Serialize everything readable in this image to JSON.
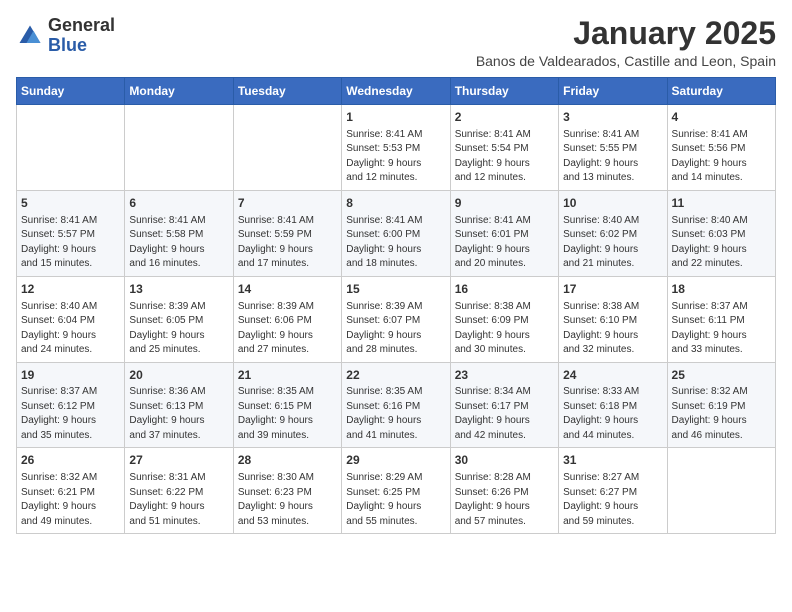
{
  "header": {
    "logo_general": "General",
    "logo_blue": "Blue",
    "month": "January 2025",
    "location": "Banos de Valdearados, Castille and Leon, Spain"
  },
  "days_of_week": [
    "Sunday",
    "Monday",
    "Tuesday",
    "Wednesday",
    "Thursday",
    "Friday",
    "Saturday"
  ],
  "weeks": [
    [
      {
        "day": "",
        "info": ""
      },
      {
        "day": "",
        "info": ""
      },
      {
        "day": "",
        "info": ""
      },
      {
        "day": "1",
        "info": "Sunrise: 8:41 AM\nSunset: 5:53 PM\nDaylight: 9 hours\nand 12 minutes."
      },
      {
        "day": "2",
        "info": "Sunrise: 8:41 AM\nSunset: 5:54 PM\nDaylight: 9 hours\nand 12 minutes."
      },
      {
        "day": "3",
        "info": "Sunrise: 8:41 AM\nSunset: 5:55 PM\nDaylight: 9 hours\nand 13 minutes."
      },
      {
        "day": "4",
        "info": "Sunrise: 8:41 AM\nSunset: 5:56 PM\nDaylight: 9 hours\nand 14 minutes."
      }
    ],
    [
      {
        "day": "5",
        "info": "Sunrise: 8:41 AM\nSunset: 5:57 PM\nDaylight: 9 hours\nand 15 minutes."
      },
      {
        "day": "6",
        "info": "Sunrise: 8:41 AM\nSunset: 5:58 PM\nDaylight: 9 hours\nand 16 minutes."
      },
      {
        "day": "7",
        "info": "Sunrise: 8:41 AM\nSunset: 5:59 PM\nDaylight: 9 hours\nand 17 minutes."
      },
      {
        "day": "8",
        "info": "Sunrise: 8:41 AM\nSunset: 6:00 PM\nDaylight: 9 hours\nand 18 minutes."
      },
      {
        "day": "9",
        "info": "Sunrise: 8:41 AM\nSunset: 6:01 PM\nDaylight: 9 hours\nand 20 minutes."
      },
      {
        "day": "10",
        "info": "Sunrise: 8:40 AM\nSunset: 6:02 PM\nDaylight: 9 hours\nand 21 minutes."
      },
      {
        "day": "11",
        "info": "Sunrise: 8:40 AM\nSunset: 6:03 PM\nDaylight: 9 hours\nand 22 minutes."
      }
    ],
    [
      {
        "day": "12",
        "info": "Sunrise: 8:40 AM\nSunset: 6:04 PM\nDaylight: 9 hours\nand 24 minutes."
      },
      {
        "day": "13",
        "info": "Sunrise: 8:39 AM\nSunset: 6:05 PM\nDaylight: 9 hours\nand 25 minutes."
      },
      {
        "day": "14",
        "info": "Sunrise: 8:39 AM\nSunset: 6:06 PM\nDaylight: 9 hours\nand 27 minutes."
      },
      {
        "day": "15",
        "info": "Sunrise: 8:39 AM\nSunset: 6:07 PM\nDaylight: 9 hours\nand 28 minutes."
      },
      {
        "day": "16",
        "info": "Sunrise: 8:38 AM\nSunset: 6:09 PM\nDaylight: 9 hours\nand 30 minutes."
      },
      {
        "day": "17",
        "info": "Sunrise: 8:38 AM\nSunset: 6:10 PM\nDaylight: 9 hours\nand 32 minutes."
      },
      {
        "day": "18",
        "info": "Sunrise: 8:37 AM\nSunset: 6:11 PM\nDaylight: 9 hours\nand 33 minutes."
      }
    ],
    [
      {
        "day": "19",
        "info": "Sunrise: 8:37 AM\nSunset: 6:12 PM\nDaylight: 9 hours\nand 35 minutes."
      },
      {
        "day": "20",
        "info": "Sunrise: 8:36 AM\nSunset: 6:13 PM\nDaylight: 9 hours\nand 37 minutes."
      },
      {
        "day": "21",
        "info": "Sunrise: 8:35 AM\nSunset: 6:15 PM\nDaylight: 9 hours\nand 39 minutes."
      },
      {
        "day": "22",
        "info": "Sunrise: 8:35 AM\nSunset: 6:16 PM\nDaylight: 9 hours\nand 41 minutes."
      },
      {
        "day": "23",
        "info": "Sunrise: 8:34 AM\nSunset: 6:17 PM\nDaylight: 9 hours\nand 42 minutes."
      },
      {
        "day": "24",
        "info": "Sunrise: 8:33 AM\nSunset: 6:18 PM\nDaylight: 9 hours\nand 44 minutes."
      },
      {
        "day": "25",
        "info": "Sunrise: 8:32 AM\nSunset: 6:19 PM\nDaylight: 9 hours\nand 46 minutes."
      }
    ],
    [
      {
        "day": "26",
        "info": "Sunrise: 8:32 AM\nSunset: 6:21 PM\nDaylight: 9 hours\nand 49 minutes."
      },
      {
        "day": "27",
        "info": "Sunrise: 8:31 AM\nSunset: 6:22 PM\nDaylight: 9 hours\nand 51 minutes."
      },
      {
        "day": "28",
        "info": "Sunrise: 8:30 AM\nSunset: 6:23 PM\nDaylight: 9 hours\nand 53 minutes."
      },
      {
        "day": "29",
        "info": "Sunrise: 8:29 AM\nSunset: 6:25 PM\nDaylight: 9 hours\nand 55 minutes."
      },
      {
        "day": "30",
        "info": "Sunrise: 8:28 AM\nSunset: 6:26 PM\nDaylight: 9 hours\nand 57 minutes."
      },
      {
        "day": "31",
        "info": "Sunrise: 8:27 AM\nSunset: 6:27 PM\nDaylight: 9 hours\nand 59 minutes."
      },
      {
        "day": "",
        "info": ""
      }
    ]
  ]
}
